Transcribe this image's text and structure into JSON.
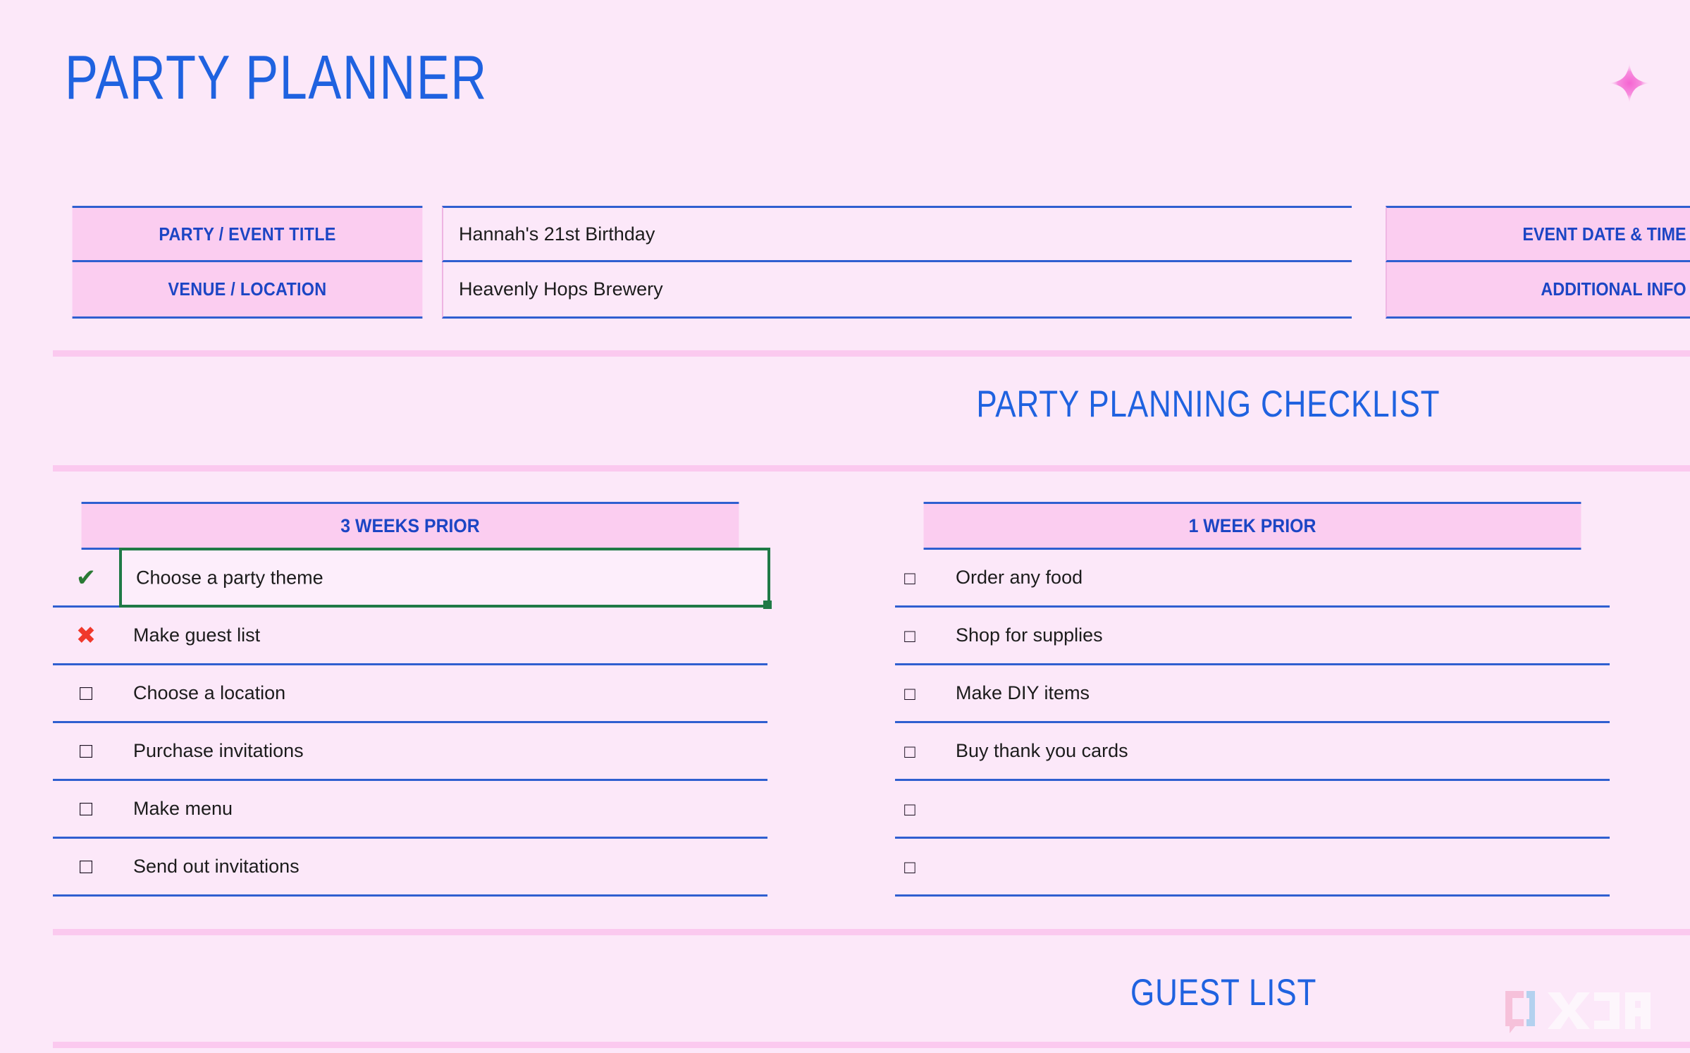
{
  "document": {
    "title": "PARTY PLANNER",
    "sparkle_icon": "sparkle-icon"
  },
  "info": {
    "rows": [
      {
        "label": "PARTY / EVENT TITLE",
        "value": "Hannah's 21st Birthday",
        "right_label": "EVENT DATE & TIME",
        "right_value": ""
      },
      {
        "label": "VENUE / LOCATION",
        "value": "Heavenly Hops Brewery",
        "right_label": "ADDITIONAL INFO",
        "right_value": ""
      }
    ]
  },
  "checklist": {
    "heading": "PARTY PLANNING CHECKLIST",
    "columns": [
      {
        "header": "3 WEEKS PRIOR",
        "items": [
          {
            "mark": "check",
            "glyph": "✔",
            "text": "Choose a party theme",
            "selected": true
          },
          {
            "mark": "cross",
            "glyph": "✖",
            "text": "Make guest list",
            "selected": false
          },
          {
            "mark": "empty",
            "glyph": "□",
            "text": "Choose a location",
            "selected": false
          },
          {
            "mark": "empty",
            "glyph": "□",
            "text": "Purchase invitations",
            "selected": false
          },
          {
            "mark": "empty",
            "glyph": "□",
            "text": "Make menu",
            "selected": false
          },
          {
            "mark": "empty",
            "glyph": "□",
            "text": "Send out invitations",
            "selected": false
          }
        ]
      },
      {
        "header": "1 WEEK PRIOR",
        "items": [
          {
            "mark": "empty",
            "glyph": "□",
            "text": "Order any food",
            "selected": false
          },
          {
            "mark": "empty",
            "glyph": "□",
            "text": "Shop for supplies",
            "selected": false
          },
          {
            "mark": "empty",
            "glyph": "□",
            "text": "Make DIY items",
            "selected": false
          },
          {
            "mark": "empty",
            "glyph": "□",
            "text": "Buy thank you cards",
            "selected": false
          },
          {
            "mark": "empty",
            "glyph": "□",
            "text": "",
            "selected": false
          },
          {
            "mark": "empty",
            "glyph": "□",
            "text": "",
            "selected": false
          }
        ]
      }
    ]
  },
  "guest_list": {
    "heading": "GUEST LIST"
  },
  "watermark": {
    "text": "XDA"
  },
  "colors": {
    "background": "#fce8f9",
    "header_pink": "#fbcdf0",
    "divider_pink": "#fbc9ef",
    "blue_rule": "#2f5fd0",
    "title_blue": "#1f62e0",
    "label_blue": "#1c45c4",
    "check_green": "#2a7a35",
    "cross_red": "#f0392b",
    "selection_green": "#1f7a46"
  }
}
